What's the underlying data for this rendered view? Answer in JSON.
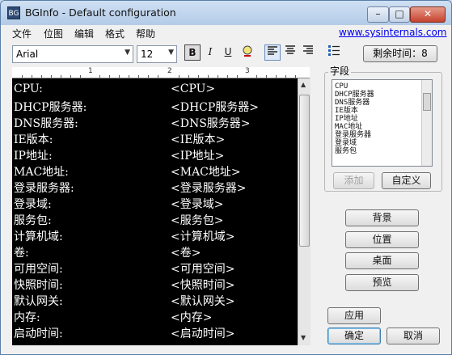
{
  "window": {
    "title": "BGInfo - Default configuration",
    "icon_label": "BG",
    "min_glyph": "–",
    "max_glyph": "□",
    "close_glyph": "✕"
  },
  "menu": {
    "items": [
      "文件",
      "位图",
      "编辑",
      "格式",
      "帮助"
    ],
    "link": "www.sysinternals.com"
  },
  "toolbar": {
    "font": "Arial",
    "size": "12",
    "bold": "B",
    "italic": "I",
    "underline": "U",
    "timeout_label": "剩余时间：8"
  },
  "ruler": {
    "numbers": [
      "1",
      "2",
      "3"
    ]
  },
  "editor": {
    "rows": [
      {
        "label": "CPU:",
        "value": "<CPU>"
      },
      {
        "label": "DHCP服务器:",
        "value": "<DHCP服务器>"
      },
      {
        "label": "DNS服务器:",
        "value": "<DNS服务器>"
      },
      {
        "label": "IE版本:",
        "value": "<IE版本>"
      },
      {
        "label": "IP地址:",
        "value": "<IP地址>"
      },
      {
        "label": "MAC地址:",
        "value": "<MAC地址>"
      },
      {
        "label": "登录服务器:",
        "value": "<登录服务器>"
      },
      {
        "label": "登录域:",
        "value": "<登录域>"
      },
      {
        "label": "服务包:",
        "value": "<服务包>"
      },
      {
        "label": "计算机域:",
        "value": "<计算机域>"
      },
      {
        "label": "卷:",
        "value": "<卷>"
      },
      {
        "label": "可用空间:",
        "value": "<可用空间>"
      },
      {
        "label": "快照时间:",
        "value": "<快照时间>"
      },
      {
        "label": "默认网关:",
        "value": "<默认网关>"
      },
      {
        "label": "内存:",
        "value": "<内存>"
      },
      {
        "label": "启动时间:",
        "value": "<启动时间>"
      }
    ]
  },
  "fields": {
    "title": "字段",
    "items": [
      "CPU",
      "DHCP服务器",
      "DNS服务器",
      "IE版本",
      "IP地址",
      "MAC地址",
      "登录服务器",
      "登录域",
      "服务包"
    ],
    "add_label": "添加",
    "custom_label": "自定义"
  },
  "buttons": {
    "background": "背景",
    "position": "位置",
    "desktop": "桌面",
    "preview": "预览",
    "apply": "应用",
    "ok": "确定",
    "cancel": "取消"
  }
}
